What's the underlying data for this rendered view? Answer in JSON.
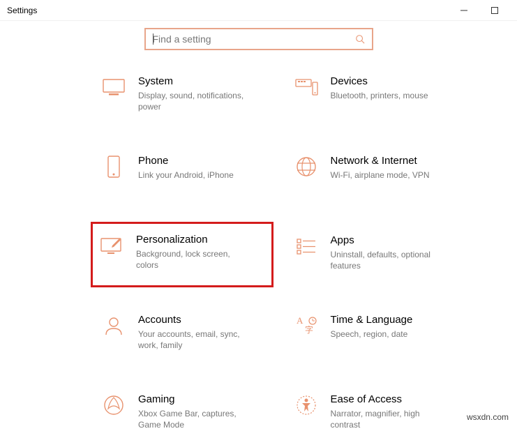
{
  "window": {
    "title": "Settings"
  },
  "search": {
    "placeholder": "Find a setting"
  },
  "tiles": {
    "system": {
      "title": "System",
      "desc": "Display, sound, notifications, power"
    },
    "devices": {
      "title": "Devices",
      "desc": "Bluetooth, printers, mouse"
    },
    "phone": {
      "title": "Phone",
      "desc": "Link your Android, iPhone"
    },
    "network": {
      "title": "Network & Internet",
      "desc": "Wi-Fi, airplane mode, VPN"
    },
    "personalization": {
      "title": "Personalization",
      "desc": "Background, lock screen, colors"
    },
    "apps": {
      "title": "Apps",
      "desc": "Uninstall, defaults, optional features"
    },
    "accounts": {
      "title": "Accounts",
      "desc": "Your accounts, email, sync, work, family"
    },
    "time": {
      "title": "Time & Language",
      "desc": "Speech, region, date"
    },
    "gaming": {
      "title": "Gaming",
      "desc": "Xbox Game Bar, captures, Game Mode"
    },
    "ease": {
      "title": "Ease of Access",
      "desc": "Narrator, magnifier, high contrast"
    }
  },
  "watermark": "wsxdn.com",
  "colors": {
    "accent": "#e8926e",
    "highlight": "#d41c1c",
    "searchBorder": "#e8a58a"
  }
}
